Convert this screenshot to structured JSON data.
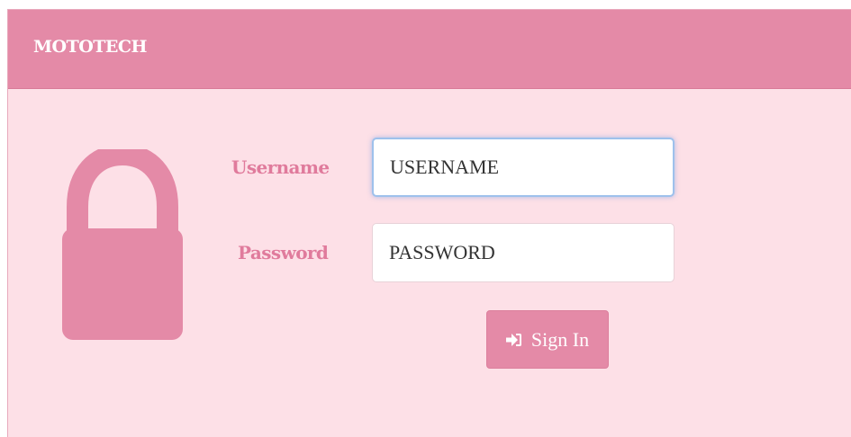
{
  "header": {
    "brand": "MOTOTECH"
  },
  "login_form": {
    "username_label": "Username",
    "username_placeholder": "USERNAME",
    "password_label": "Password",
    "password_placeholder": "PASSWORD",
    "signin_label": "Sign In"
  },
  "icons": {
    "lock": "lock-icon",
    "signin": "sign-in-icon"
  },
  "colors": {
    "accent": "#e48aa7",
    "panel_bg": "#fde0e7",
    "label_text": "#e07b9c"
  }
}
